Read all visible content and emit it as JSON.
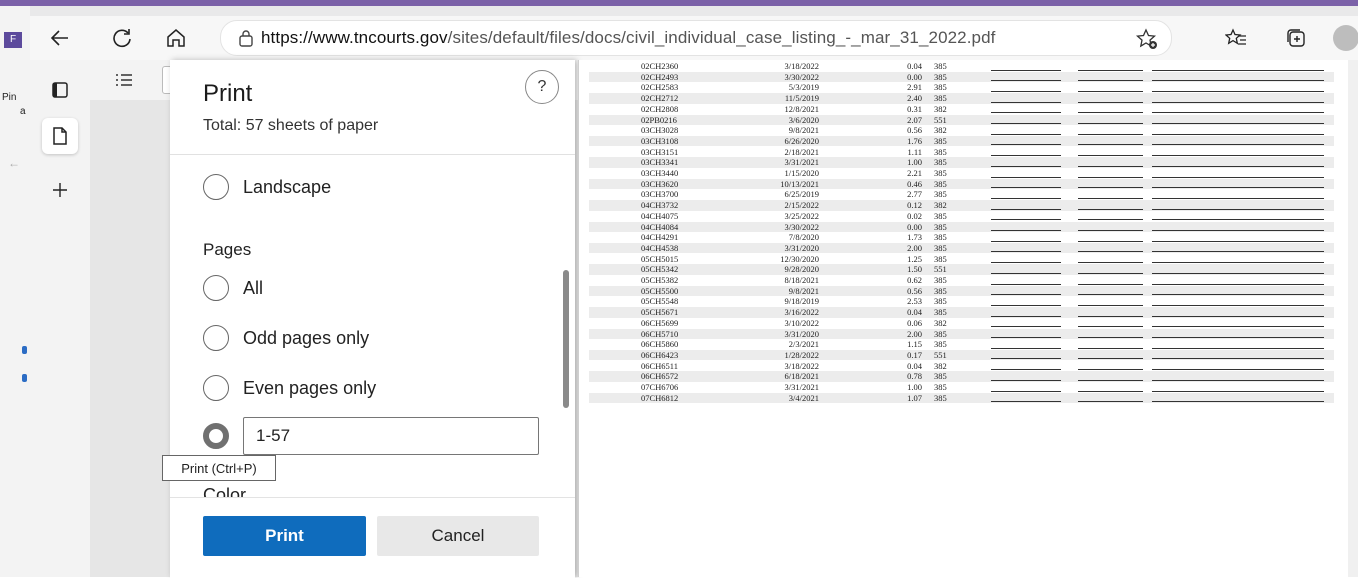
{
  "browser": {
    "url_domain": "https://www.tncourts.gov",
    "url_path": "/sites/default/files/docs/civil_individual_case_listing_-_mar_31_2022.pdf",
    "outer_badge": "F",
    "outer_pin_label": "Pin",
    "outer_pin_sub": "a"
  },
  "print_dialog": {
    "title": "Print",
    "subtitle": "Total: 57 sheets of paper",
    "help_label": "?",
    "orientation_option": "Landscape",
    "pages_heading": "Pages",
    "page_options": [
      "All",
      "Odd pages only",
      "Even pages only"
    ],
    "custom_range_value": "1-57",
    "next_section_heading": "Color",
    "print_button": "Print",
    "cancel_button": "Cancel",
    "tooltip": "Print (Ctrl+P)"
  },
  "preview": {
    "rows": [
      [
        "02CH2360",
        "3/18/2022",
        "0.04",
        "385"
      ],
      [
        "02CH2493",
        "3/30/2022",
        "0.00",
        "385"
      ],
      [
        "02CH2583",
        "5/3/2019",
        "2.91",
        "385"
      ],
      [
        "02CH2712",
        "11/5/2019",
        "2.40",
        "385"
      ],
      [
        "02CH2808",
        "12/8/2021",
        "0.31",
        "382"
      ],
      [
        "02PB0216",
        "3/6/2020",
        "2.07",
        "551"
      ],
      [
        "03CH3028",
        "9/8/2021",
        "0.56",
        "382"
      ],
      [
        "03CH3108",
        "6/26/2020",
        "1.76",
        "385"
      ],
      [
        "03CH3151",
        "2/18/2021",
        "1.11",
        "385"
      ],
      [
        "03CH3341",
        "3/31/2021",
        "1.00",
        "385"
      ],
      [
        "03CH3440",
        "1/15/2020",
        "2.21",
        "385"
      ],
      [
        "03CH3620",
        "10/13/2021",
        "0.46",
        "385"
      ],
      [
        "03CH3700",
        "6/25/2019",
        "2.77",
        "385"
      ],
      [
        "04CH3732",
        "2/15/2022",
        "0.12",
        "382"
      ],
      [
        "04CH4075",
        "3/25/2022",
        "0.02",
        "385"
      ],
      [
        "04CH4084",
        "3/30/2022",
        "0.00",
        "385"
      ],
      [
        "04CH4291",
        "7/8/2020",
        "1.73",
        "385"
      ],
      [
        "04CH4538",
        "3/31/2020",
        "2.00",
        "385"
      ],
      [
        "05CH5015",
        "12/30/2020",
        "1.25",
        "385"
      ],
      [
        "05CH5342",
        "9/28/2020",
        "1.50",
        "551"
      ],
      [
        "05CH5382",
        "8/18/2021",
        "0.62",
        "385"
      ],
      [
        "05CH5500",
        "9/8/2021",
        "0.56",
        "385"
      ],
      [
        "05CH5548",
        "9/18/2019",
        "2.53",
        "385"
      ],
      [
        "05CH5671",
        "3/16/2022",
        "0.04",
        "385"
      ],
      [
        "06CH5699",
        "3/10/2022",
        "0.06",
        "382"
      ],
      [
        "06CH5710",
        "3/31/2020",
        "2.00",
        "385"
      ],
      [
        "06CH5860",
        "2/3/2021",
        "1.15",
        "385"
      ],
      [
        "06CH6423",
        "1/28/2022",
        "0.17",
        "551"
      ],
      [
        "06CH6511",
        "3/18/2022",
        "0.04",
        "382"
      ],
      [
        "06CH6572",
        "6/18/2021",
        "0.78",
        "385"
      ],
      [
        "07CH6706",
        "3/31/2021",
        "1.00",
        "385"
      ],
      [
        "07CH6812",
        "3/4/2021",
        "1.07",
        "385"
      ]
    ]
  }
}
